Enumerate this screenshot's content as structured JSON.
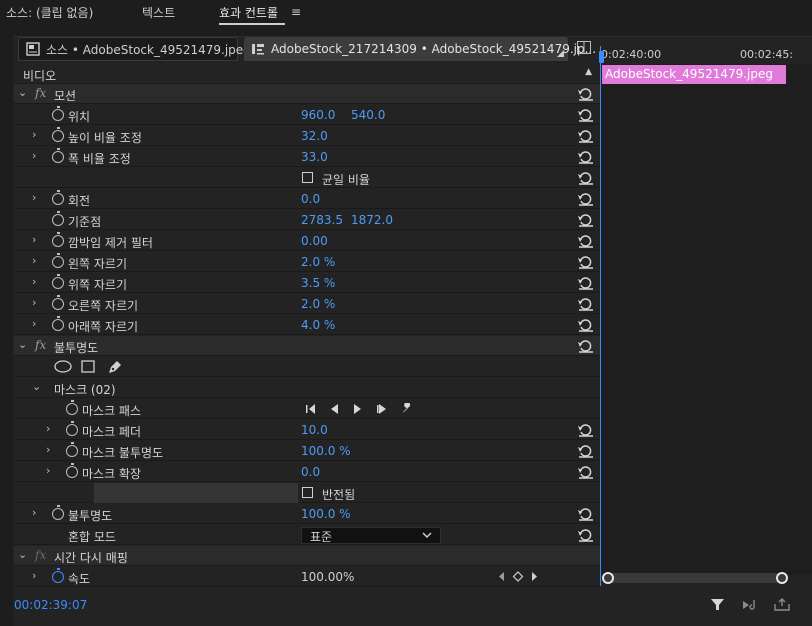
{
  "tabs": [
    {
      "label": "소스: (클립 없음)"
    },
    {
      "label": "텍스트"
    },
    {
      "label": "효과 컨트롤"
    }
  ],
  "menu_glyph": "≡",
  "clip_tabs": {
    "source": "소스 • AdobeStock_49521479.jpeg",
    "sequence": "AdobeStock_217214309 • AdobeStock_49521479.jp..."
  },
  "timeline": {
    "time_start": "0:02:40:00",
    "time_end": "00:02:45:",
    "clip_name": "AdobeStock_49521479.jpeg"
  },
  "section_video": "비디오",
  "motion": {
    "title": "모션",
    "position": {
      "label": "위치",
      "x": "960.0",
      "y": "540.0"
    },
    "scale_height": {
      "label": "높이 비율 조정",
      "value": "32.0"
    },
    "scale_width": {
      "label": "폭 비율 조정",
      "value": "33.0"
    },
    "uniform_scale": {
      "label": "균일 비율"
    },
    "rotation": {
      "label": "회전",
      "value": "0.0"
    },
    "anchor": {
      "label": "기준점",
      "x": "2783.5",
      "y": "1872.0"
    },
    "flicker": {
      "label": "깜박임 제거 필터",
      "value": "0.00"
    },
    "crop_left": {
      "label": "왼쪽 자르기",
      "value": "2.0 %"
    },
    "crop_top": {
      "label": "위쪽 자르기",
      "value": "3.5 %"
    },
    "crop_right": {
      "label": "오른쪽 자르기",
      "value": "2.0 %"
    },
    "crop_bottom": {
      "label": "아래쪽 자르기",
      "value": "4.0 %"
    }
  },
  "opacity": {
    "title": "불투명도",
    "mask_title": "마스크 (02)",
    "mask_path": "마스크 패스",
    "mask_feather": {
      "label": "마스크 페더",
      "value": "10.0"
    },
    "mask_opacity": {
      "label": "마스크 불투명도",
      "value": "100.0 %"
    },
    "mask_expansion": {
      "label": "마스크 확장",
      "value": "0.0"
    },
    "inverted": {
      "label": "반전됨"
    },
    "opacity_prop": {
      "label": "불투명도",
      "value": "100.0 %"
    },
    "blend_mode": {
      "label": "혼합 모드",
      "value": "표준"
    }
  },
  "time_remap": {
    "title": "시간 다시 매핑",
    "speed": {
      "label": "속도",
      "value": "100.00%"
    }
  },
  "footer": {
    "timecode": "00:02:39:07"
  },
  "colors": {
    "accent": "#3a8cff",
    "clip": "#e07bd9",
    "value": "#4f9bf5"
  }
}
